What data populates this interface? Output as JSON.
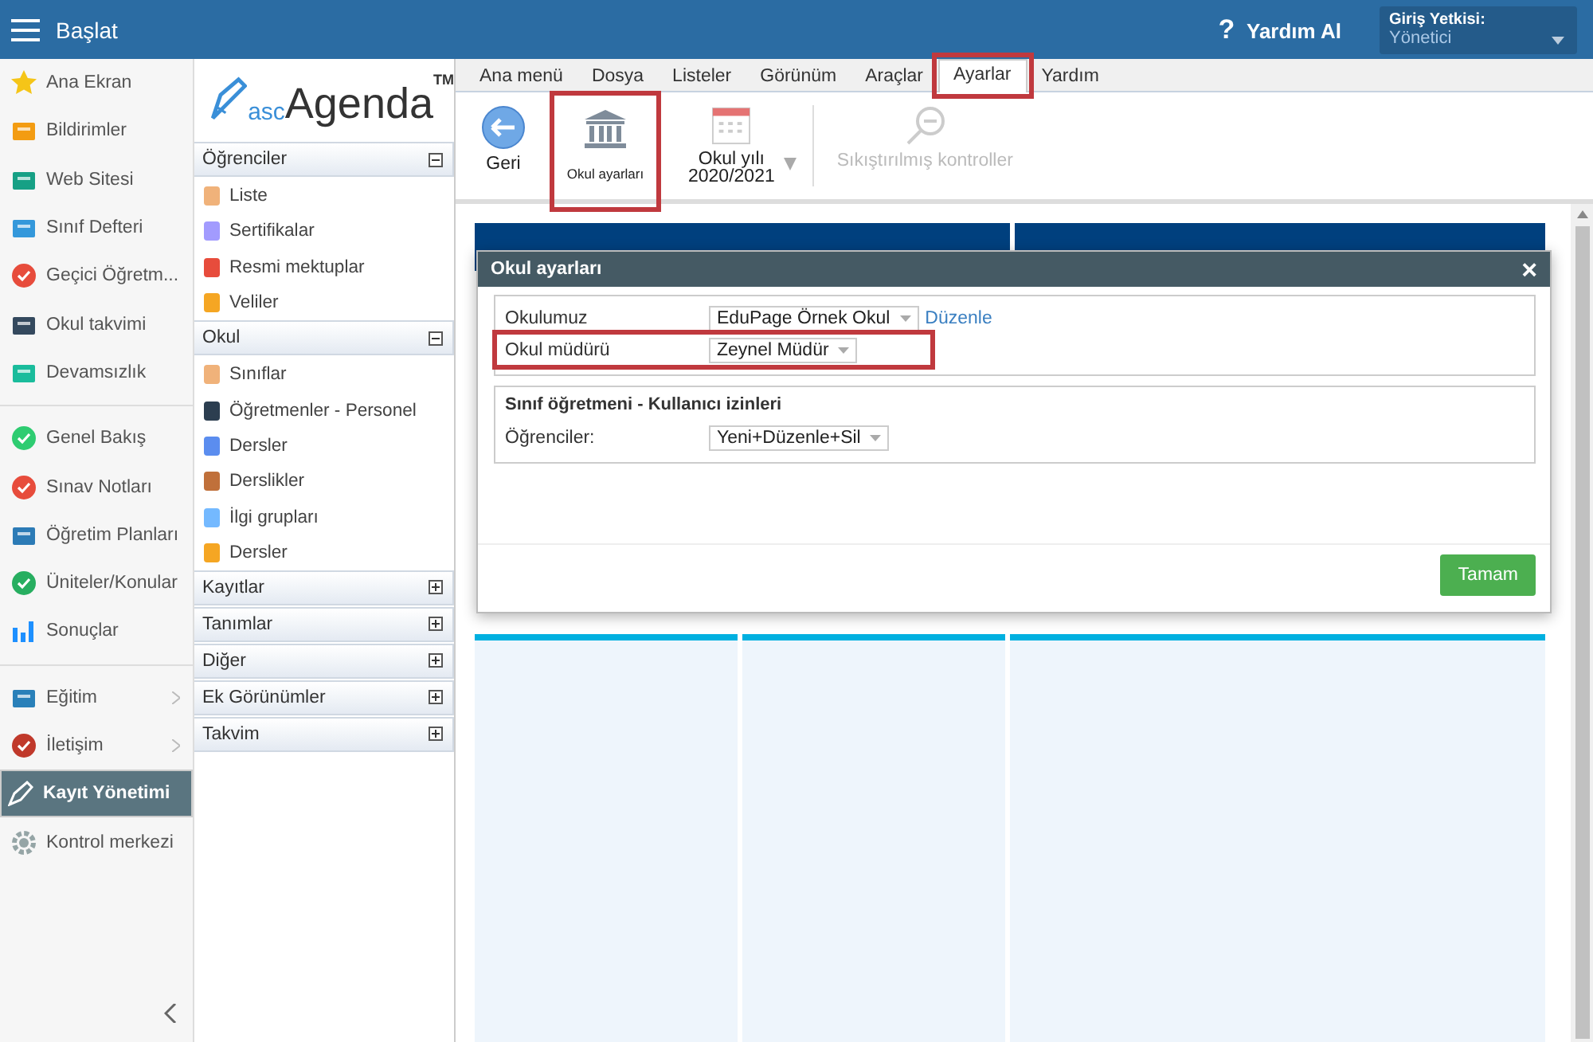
{
  "top_bar": {
    "menu_label": "Başlat",
    "help_icon": "?",
    "help": "Yardım Al",
    "role_label": "Giriş Yetkisi:",
    "role_value": "Yönetici"
  },
  "sidebar": {
    "groups": [
      [
        {
          "label": "Ana Ekran",
          "selected": false,
          "has_submenu": false
        },
        {
          "label": "Bildirimler",
          "selected": false,
          "has_submenu": false
        },
        {
          "label": "Web Sitesi",
          "selected": false,
          "has_submenu": false
        },
        {
          "label": "Sınıf Defteri",
          "selected": false,
          "has_submenu": false
        },
        {
          "label": "Geçici Öğretm...",
          "selected": false,
          "has_submenu": false
        },
        {
          "label": "Okul takvimi",
          "selected": false,
          "has_submenu": false
        },
        {
          "label": "Devamsızlık",
          "selected": false,
          "has_submenu": false
        }
      ],
      [
        {
          "label": "Genel Bakış",
          "selected": false,
          "has_submenu": false
        },
        {
          "label": "Sınav Notları",
          "selected": false,
          "has_submenu": false
        },
        {
          "label": "Öğretim Planları",
          "selected": false,
          "has_submenu": false
        },
        {
          "label": "Üniteler/Konular",
          "selected": false,
          "has_submenu": false
        },
        {
          "label": "Sonuçlar",
          "selected": false,
          "has_submenu": false
        }
      ],
      [
        {
          "label": "Eğitim",
          "selected": false,
          "has_submenu": true
        },
        {
          "label": "İletişim",
          "selected": false,
          "has_submenu": true
        },
        {
          "label": "Kayıt Yönetimi",
          "selected": true,
          "has_submenu": false
        },
        {
          "label": "Kontrol merkezi",
          "selected": false,
          "has_submenu": false
        }
      ]
    ]
  },
  "nav_panel": {
    "logo_prefix": "asc",
    "logo_name": "Agenda",
    "logo_mark": "TM",
    "sections": [
      {
        "title": "Öğrenciler",
        "expanded": true,
        "items": [
          "Liste",
          "Sertifikalar",
          "Resmi mektuplar",
          "Veliler"
        ]
      },
      {
        "title": "Okul",
        "expanded": true,
        "items": [
          "Sınıflar",
          "Öğretmenler - Personel",
          "Dersler",
          "Derslikler",
          "İlgi grupları",
          "Dersler"
        ]
      },
      {
        "title": "Kayıtlar",
        "expanded": false
      },
      {
        "title": "Tanımlar",
        "expanded": false
      },
      {
        "title": "Diğer",
        "expanded": false
      },
      {
        "title": "Ek Görünümler",
        "expanded": false
      },
      {
        "title": "Takvim",
        "expanded": false
      }
    ]
  },
  "ribbon_tabs": [
    {
      "label": "Ana menü",
      "selected": false,
      "highlighted": false
    },
    {
      "label": "Dosya",
      "selected": false,
      "highlighted": false
    },
    {
      "label": "Listeler",
      "selected": false,
      "highlighted": false
    },
    {
      "label": "Görünüm",
      "selected": false,
      "highlighted": false
    },
    {
      "label": "Araçlar",
      "selected": false,
      "highlighted": false
    },
    {
      "label": "Ayarlar",
      "selected": true,
      "highlighted": true
    },
    {
      "label": "Yardım",
      "selected": false,
      "highlighted": false
    }
  ],
  "ribbon_buttons": [
    {
      "kind": "back",
      "label": "Geri",
      "disabled": false,
      "highlighted": false
    },
    {
      "kind": "school",
      "label": "Okul ayarları",
      "disabled": false,
      "highlighted": true
    },
    {
      "kind": "year",
      "label": "Okul yılı",
      "sublabel": "2020/2021",
      "disabled": false,
      "highlighted": false
    },
    {
      "kind": "zoom",
      "label": "Sıkıştırılmış kontroller",
      "disabled": true,
      "highlighted": false
    }
  ],
  "dialog": {
    "title": "Okul ayarları",
    "close": "×",
    "fields": [
      {
        "label": "Okulumuz",
        "value": "EduPage Örnek Okul",
        "link": "Düzenle",
        "highlighted": false
      },
      {
        "label": "Okul müdürü",
        "value": "Zeynel Müdür",
        "highlighted": true
      }
    ],
    "section": {
      "title": "Sınıf öğretmeni - Kullanıcı izinleri",
      "fields": [
        {
          "label": "Öğrenciler:",
          "value": "Yeni+Düzenle+Sil",
          "highlighted": false
        }
      ]
    },
    "ok_button": "Tamam"
  }
}
